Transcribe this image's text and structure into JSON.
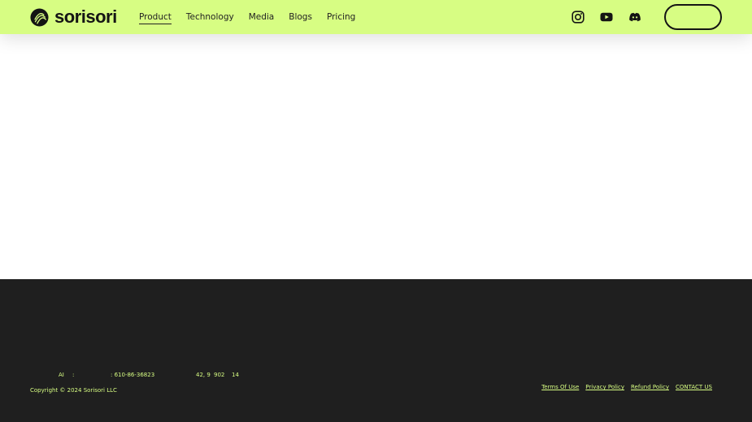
{
  "header": {
    "logo_text": "sorisori",
    "nav": [
      {
        "label": "Product",
        "active": true
      },
      {
        "label": "Technology",
        "active": false
      },
      {
        "label": "Media",
        "active": false
      },
      {
        "label": "Blogs",
        "active": false
      },
      {
        "label": "Pricing",
        "active": false
      }
    ],
    "social_icons": [
      "instagram-icon",
      "youtube-icon",
      "discord-icon"
    ],
    "cta_label": ""
  },
  "footer": {
    "company_info": [
      "AI",
      ":",
      ": 610-86-36823",
      "42, 9",
      "902",
      "14"
    ],
    "copyright": "Copyright © 2024 Sorisori LLC",
    "links": [
      "Terms Of Use",
      "Privacy Policy",
      "Refund Policy",
      "CONTACT US"
    ]
  },
  "colors": {
    "header_bg": "#d7fd83",
    "footer_bg": "#1f1f1f",
    "accent_text": "#d7fd83",
    "dark": "#141414"
  }
}
